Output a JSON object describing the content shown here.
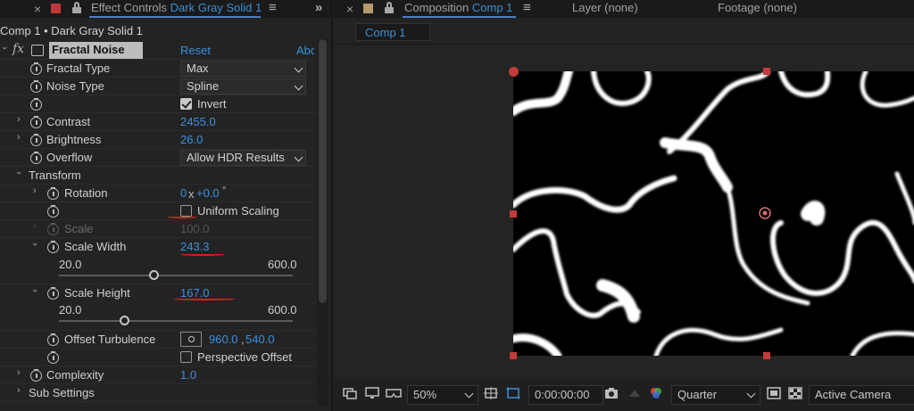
{
  "left_panel": {
    "tab_close": "×",
    "tab_label_prefix": "Effect Controls",
    "tab_label_layer": "Dark Gray Solid 1",
    "tab_menu": "≡",
    "collapse": "»",
    "breadcrumb": "Comp 1 • Dark Gray Solid 1",
    "effect": {
      "fx_label": "fx",
      "name": "Fractal Noise",
      "reset": "Reset",
      "about": "About"
    },
    "properties": {
      "fractal_type": {
        "label": "Fractal Type",
        "value": "Max"
      },
      "noise_type": {
        "label": "Noise Type",
        "value": "Spline"
      },
      "invert": {
        "label": "Invert",
        "checked": true
      },
      "contrast": {
        "label": "Contrast",
        "value": "2455.0"
      },
      "brightness": {
        "label": "Brightness",
        "value": "26.0"
      },
      "overflow": {
        "label": "Overflow",
        "value": "Allow HDR Results"
      },
      "transform": {
        "label": "Transform"
      },
      "rotation": {
        "label": "Rotation",
        "value_prefix": "0",
        "value_x": "x",
        "value_deg": "+0.0",
        "value_deg_sign": "°"
      },
      "uniform_scaling": {
        "label": "Uniform Scaling",
        "checked": false
      },
      "scale": {
        "label": "Scale",
        "value": "100.0"
      },
      "scale_width": {
        "label": "Scale Width",
        "value": "243.3",
        "slider_min": "20.0",
        "slider_max": "600.0"
      },
      "scale_height": {
        "label": "Scale Height",
        "value": "167.0",
        "slider_min": "20.0",
        "slider_max": "600.0"
      },
      "offset_turbulence": {
        "label": "Offset Turbulence",
        "value_x": "960.0",
        "value_sep": ",",
        "value_y": "540.0"
      },
      "perspective_offset": {
        "label": "Perspective Offset",
        "checked": false
      },
      "complexity": {
        "label": "Complexity",
        "value": "1.0"
      },
      "sub_settings": {
        "label": "Sub Settings"
      }
    }
  },
  "right_panel": {
    "tab_close": "×",
    "tab_label_prefix": "Composition",
    "tab_label_comp": "Comp 1",
    "tab_menu": "≡",
    "layer_tab": "Layer  (none)",
    "footage_tab": "Footage  (none)",
    "comp_chip": "Comp 1",
    "toolbar": {
      "zoom": "50%",
      "timecode": "0:00:00:00",
      "resolution": "Quarter",
      "camera": "Active Camera"
    }
  },
  "colors": {
    "accent_blue": "#3b8fd6",
    "annotation_red": "#d42020",
    "layer_swatch_red": "#c0383a",
    "comp_swatch_tan": "#b59a6a"
  }
}
